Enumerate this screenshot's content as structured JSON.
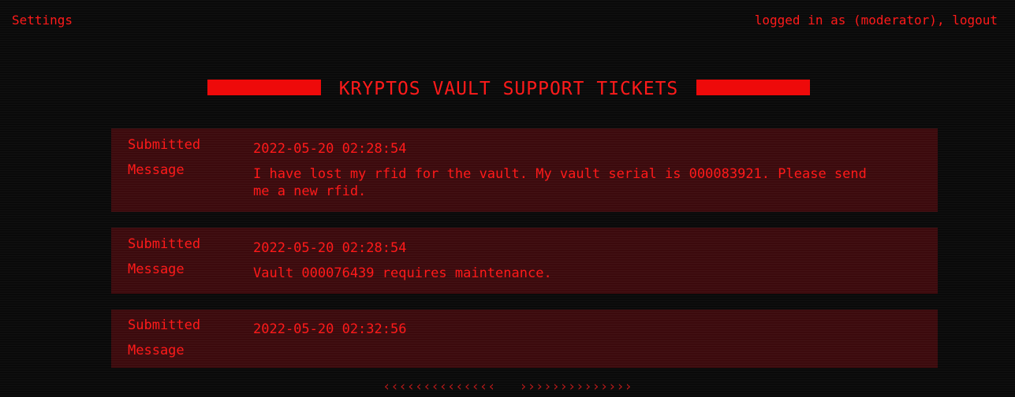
{
  "nav": {
    "settings_label": "Settings",
    "login_prefix": "logged in as (moderator), ",
    "logout_label": "logout"
  },
  "header": {
    "title": "KRYPTOS VAULT SUPPORT TICKETS"
  },
  "tickets": [
    {
      "submitted_label": "Submitted",
      "message_label": "Message",
      "submitted": "2022-05-20 02:28:54",
      "message": "I have lost my rfid for the vault. My vault serial is 000083921. Please send me a new rfid."
    },
    {
      "submitted_label": "Submitted",
      "message_label": "Message",
      "submitted": "2022-05-20 02:28:54",
      "message": "Vault 000076439 requires maintenance."
    },
    {
      "submitted_label": "Submitted",
      "message_label": "Message",
      "submitted": "2022-05-20 02:32:56",
      "message": ""
    }
  ],
  "pagination": {
    "prev_label": "‹‹‹‹‹‹‹‹‹‹‹‹‹‹",
    "next_label": "››››››››››››››"
  },
  "colors": {
    "accent": "#ff1a1a",
    "background": "#0a0a0a",
    "ticket_background": "#3c0a0d"
  }
}
